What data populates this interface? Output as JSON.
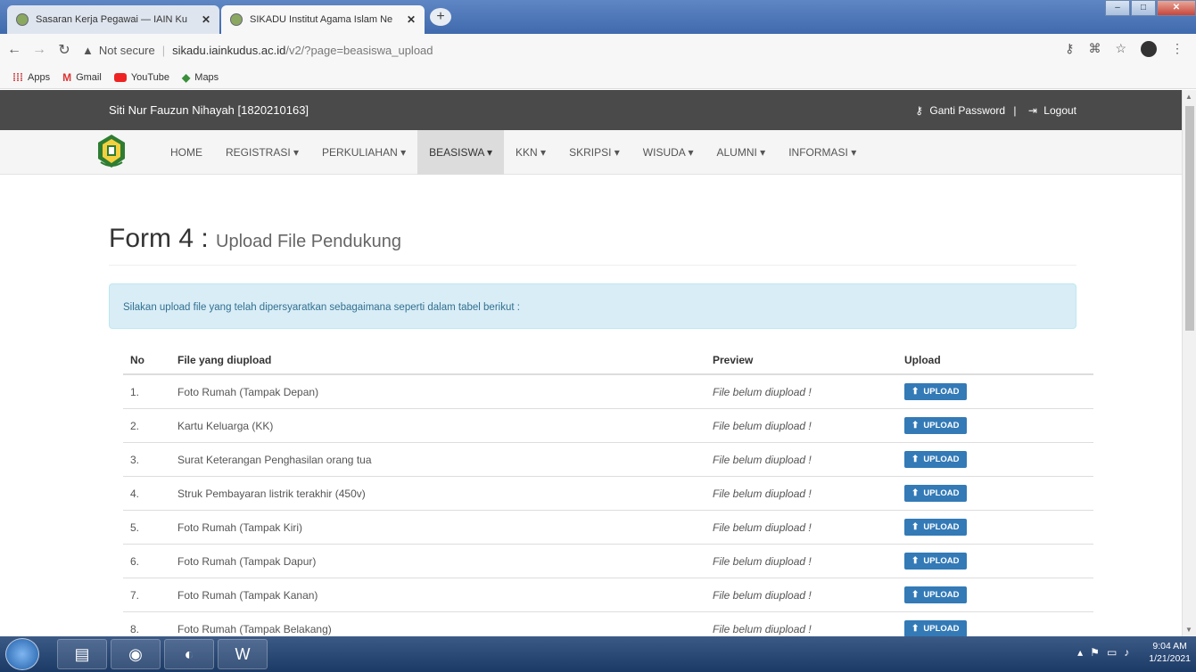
{
  "browser": {
    "tabs": [
      {
        "title": "Sasaran Kerja Pegawai — IAIN Ku",
        "active": false
      },
      {
        "title": "SIKADU Institut Agama Islam Ne",
        "active": true
      }
    ],
    "url_security": "Not secure",
    "url_host": "sikadu.iainkudus.ac.id",
    "url_path": "/v2/?page=beasiswa_upload",
    "bookmarks": [
      "Apps",
      "Gmail",
      "YouTube",
      "Maps"
    ]
  },
  "userbar": {
    "user": "Siti Nur Fauzun Nihayah [1820210163]",
    "change_password": "Ganti Password",
    "separator": "|",
    "logout": "Logout"
  },
  "menu": [
    {
      "label": "HOME",
      "active": false
    },
    {
      "label": "REGISTRASI ▾",
      "active": false
    },
    {
      "label": "PERKULIAHAN ▾",
      "active": false
    },
    {
      "label": "BEASISWA ▾",
      "active": true
    },
    {
      "label": "KKN ▾",
      "active": false
    },
    {
      "label": "SKRIPSI ▾",
      "active": false
    },
    {
      "label": "WISUDA ▾",
      "active": false
    },
    {
      "label": "ALUMNI ▾",
      "active": false
    },
    {
      "label": "INFORMASI ▾",
      "active": false
    }
  ],
  "form": {
    "title": "Form 4 :",
    "subtitle": "Upload File Pendukung",
    "info": "Silakan upload file yang telah dipersyaratkan sebagaimana seperti dalam tabel berikut :"
  },
  "table": {
    "headers": [
      "No",
      "File yang diupload",
      "Preview",
      "Upload"
    ],
    "upload_label": "UPLOAD",
    "rows": [
      {
        "no": "1.",
        "file": "Foto Rumah (Tampak Depan)",
        "preview": "File belum diupload !"
      },
      {
        "no": "2.",
        "file": "Kartu Keluarga (KK)",
        "preview": "File belum diupload !"
      },
      {
        "no": "3.",
        "file": "Surat Keterangan Penghasilan orang tua",
        "preview": "File belum diupload !"
      },
      {
        "no": "4.",
        "file": "Struk Pembayaran listrik terakhir (450v)",
        "preview": "File belum diupload !"
      },
      {
        "no": "5.",
        "file": "Foto Rumah (Tampak Kiri)",
        "preview": "File belum diupload !"
      },
      {
        "no": "6.",
        "file": "Foto Rumah (Tampak Dapur)",
        "preview": "File belum diupload !"
      },
      {
        "no": "7.",
        "file": "Foto Rumah (Tampak Kanan)",
        "preview": "File belum diupload !"
      },
      {
        "no": "8.",
        "file": "Foto Rumah (Tampak Belakang)",
        "preview": "File belum diupload !"
      }
    ]
  },
  "taskbar": {
    "time": "9:04 AM",
    "date": "1/21/2021"
  },
  "colors": {
    "primary_button": "#337ab7",
    "alert_bg": "#d9edf7",
    "userbar_bg": "#4a4a4a"
  }
}
